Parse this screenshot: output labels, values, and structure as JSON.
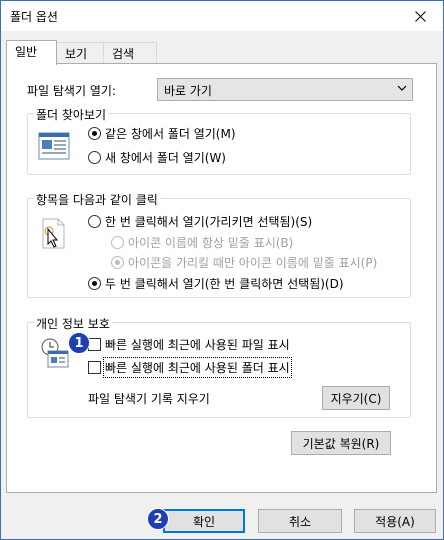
{
  "window": {
    "title": "폴더 옵션"
  },
  "tabs": [
    {
      "label": "일반"
    },
    {
      "label": "보기"
    },
    {
      "label": "검색"
    }
  ],
  "general": {
    "browse_label": "파일 탐색기 열기:",
    "browse_value": "바로 가기",
    "browse_group": {
      "title": "폴더 찾아보기",
      "options": [
        "같은 창에서 폴더 열기(M)",
        "새 창에서 폴더 열기(W)"
      ],
      "selected": 0
    },
    "click_group": {
      "title": "항목을 다음과 같이 클릭",
      "single": "한 번 클릭해서 열기(가리키면 선택됨)(S)",
      "sub1": "아이콘 이름에 항상 밑줄 표시(B)",
      "sub2": "아이콘을 가리킬 때만 아이콘 이름에 밑줄 표시(P)",
      "double": "두 번 클릭해서 열기(한 번 클릭하면 선택됨)(D)"
    },
    "privacy_group": {
      "title": "개인 정보 보호",
      "check1": "빠른 실행에 최근에 사용된 파일 표시",
      "check2": "빠른 실행에 최근에 사용된 폴더 표시",
      "clear_label": "파일 탐색기 기록 지우기",
      "clear_button": "지우기(C)"
    },
    "restore_button": "기본값 복원(R)"
  },
  "footer": {
    "ok": "확인",
    "cancel": "취소",
    "apply": "적용(A)"
  },
  "badges": [
    "1",
    "2"
  ],
  "colors": {
    "badge": "#1e3fb4",
    "accent": "#0078d7"
  }
}
